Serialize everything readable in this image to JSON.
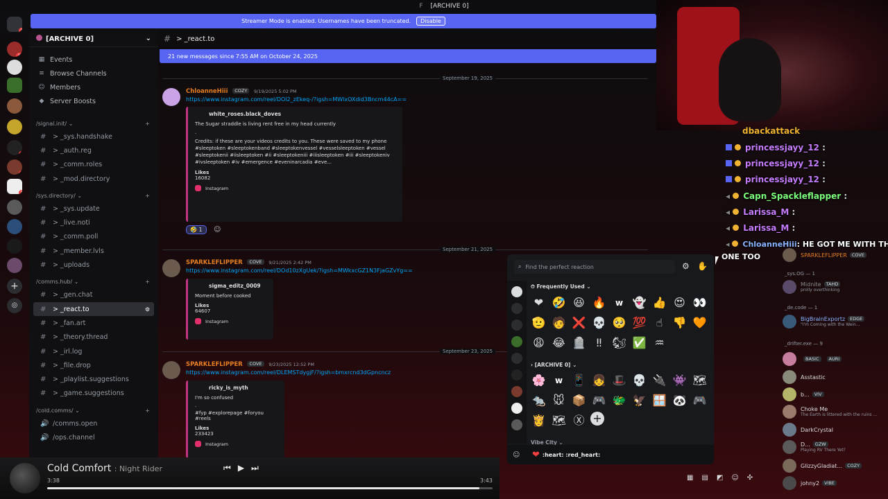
{
  "window": {
    "title": "[ARCHIVE 0]",
    "title_prefix": "F"
  },
  "streamer_banner": {
    "text": "Streamer Mode is enabled. Usernames have been truncated.",
    "button": "Disable"
  },
  "server": {
    "name": "[ARCHIVE 0]"
  },
  "nav": [
    {
      "label": "Events",
      "icon": "calendar-icon"
    },
    {
      "label": "Browse Channels",
      "icon": "browse-icon"
    },
    {
      "label": "Members",
      "icon": "members-icon"
    },
    {
      "label": "Server Boosts",
      "icon": "boost-icon"
    }
  ],
  "categories": [
    {
      "name": "/signal.init/",
      "channels": [
        "> _sys.handshake",
        "> _auth.reg",
        "> _comm.roles",
        "> _mod.directory"
      ]
    },
    {
      "name": "/sys.directory/",
      "channels": [
        "> _sys.update",
        "> _live.noti",
        "> _comm.poll",
        "> _member.lvls",
        "> _uploads"
      ]
    },
    {
      "name": "/comms.hub/",
      "channels": [
        "> _gen.chat",
        "> _react.to",
        "> _fan.art",
        "> _theory.thread",
        "> _irl.log",
        "> _file.drop",
        "> _playlist.suggestions",
        "> _game.suggestions"
      ]
    },
    {
      "name": "/cold.comms/",
      "channels": [
        "/comms.open",
        "/ops.channel"
      ]
    }
  ],
  "active_channel": "> _react.to",
  "new_messages_bar": "21 new messages since 7:55 AM on October 24, 2025",
  "dates": [
    "September 19, 2025",
    "September 21, 2025",
    "September 23, 2025"
  ],
  "messages": [
    {
      "user": "ChloanneHiii",
      "tag": "COZY",
      "time": "9/19/2025 5:02 PM",
      "user_color": "#e67e22",
      "link": "https://www.instagram.com/reel/DOl2_zEkeq-/?igsh=MWlxOXdid3Bncm44cA==",
      "embed": {
        "author": "white_roses.black_doves",
        "text": "The Sugar straddle is living rent free in my head currently",
        "dots": ".",
        "credits": "Credits: if these are your videos credits to you. These were saved to my phone #sleeptoken #sleeptokenband #sleeptokenvessel #vesselsleeptoken #vessel #sleeptokenii #iisleeptoken #ii #sleeptokeniii #iiisleeptoken #iii #sleeptokeniv #ivsleeptoken #iv #emergence #eveninarcadia #eve...",
        "likes_label": "Likes",
        "likes": "16082",
        "source": "Instagram"
      },
      "reaction_count": "1"
    },
    {
      "user": "SPARKLEFLIPPER",
      "tag": "COVE",
      "time": "9/21/2025 2:42 PM",
      "user_color": "#e67e22",
      "link": "https://www.instagram.com/reel/DOd10zXgUek/?igsh=MWkxcGZ1N3FjaGZvYg==",
      "embed": {
        "author": "sigma_editz_0009",
        "text": "Moment before cooked",
        "likes_label": "Likes",
        "likes": "64607",
        "source": "Instagram"
      }
    },
    {
      "user": "SPARKLEFLIPPER",
      "tag": "COVE",
      "time": "9/23/2025 12:52 PM",
      "user_color": "#e67e22",
      "link": "https://www.instagram.com/reel/DLEMSTdygjF/?igsh=bmxrcnd3dGpncncz",
      "embed": {
        "author": "ricky_is_myth",
        "text": "I'm so confused",
        "dots": ".",
        "hashtags": "#fyp #explorepage #foryou #reels",
        "likes_label": "Likes",
        "likes": "233423",
        "source": "Instagram"
      }
    }
  ],
  "picker": {
    "placeholder": "Find the perfect reaction",
    "frequent_label": "Frequently Used",
    "server_label": "[ARCHIVE 0]",
    "next_label": "Vibe City",
    "footer": ":heart: :red_heart:",
    "frequent": [
      "❤",
      "🤣",
      "😆",
      "🔥",
      "ᴡ",
      "👻",
      "👍",
      "😍",
      "👀",
      "🫡",
      "🧑",
      "❌",
      "💀",
      "🥺",
      "💯",
      "☝",
      "👎",
      "🧡",
      "😩",
      "😂",
      "🪦",
      "‼",
      "🐿",
      "✅",
      "♒"
    ],
    "server": [
      "🌸",
      "ᴡ",
      "📱",
      "👧",
      "🎩",
      "💀",
      "🔌",
      "👾",
      "🗺",
      "🐀",
      "🐭",
      "📦",
      "🎮",
      "🐲",
      "🦅",
      "🪟",
      "🐼",
      "🎮",
      "👸",
      "🗺",
      "Ⓧ",
      "+"
    ]
  },
  "player": {
    "title": "Cold Comfort",
    "artist": "Night Rider",
    "elapsed": "3:38",
    "total": "3:43",
    "progress": 0.97
  },
  "chat_overlay": [
    {
      "name": "dbackattack",
      "msg": "",
      "color": "#f0b232"
    },
    {
      "name": "princessjayy_12",
      "msg": ":",
      "color": "#c77dff"
    },
    {
      "name": "princessjayy_12",
      "msg": ":",
      "color": "#c77dff"
    },
    {
      "name": "princessjayy_12",
      "msg": ":",
      "color": "#c77dff"
    },
    {
      "name": "Capn_Spackleflapper",
      "msg": ":",
      "color": "#7dff7d"
    },
    {
      "name": "Larissa_M",
      "msg": ":",
      "color": "#c77dff"
    },
    {
      "name": "Larissa_M",
      "msg": ":",
      "color": "#c77dff"
    },
    {
      "name": "ChloanneHiii",
      "msg": ": HE GOT ME WITH THAT",
      "color": "#8ab4ff"
    },
    {
      "name": "",
      "msg": "ONE TOO",
      "color": "#fff"
    }
  ],
  "members": {
    "groups": [
      "_sys.OG — 1",
      "_de.code — 1",
      "_drifter.exe — 9"
    ],
    "list": [
      {
        "name": "SPARKLEFLIPPER",
        "tag": "COVE",
        "color": "#e67e22"
      },
      {
        "name": "Midnite",
        "tag": "TAHD",
        "sub": "prolly overthinking",
        "color": "#8a8a8a"
      },
      {
        "name": "BigBrainExportz",
        "tag": "EDGE",
        "sub": "\"I'm Coming with the Wein...",
        "color": "#8ab4ff"
      },
      {
        "name": "",
        "tag": "BASIC",
        "tag2": "AURI",
        "color": "#dbdee1"
      },
      {
        "name": "Asstastic",
        "color": "#dbdee1"
      },
      {
        "name": "b...",
        "tag": "VIV",
        "color": "#dbdee1"
      },
      {
        "name": "Choke Me",
        "sub": "The Earth is littered with the ruins ...",
        "color": "#dbdee1"
      },
      {
        "name": "DarkCrystal",
        "color": "#dbdee1"
      },
      {
        "name": "D...",
        "tag": "GZW",
        "sub": "Playing RV There Yet?",
        "color": "#dbdee1"
      },
      {
        "name": "GlizzyGladiat...",
        "tag": "COZY",
        "color": "#dbdee1"
      },
      {
        "name": "johny2",
        "tag": "VIBE",
        "color": "#dbdee1"
      }
    ]
  }
}
